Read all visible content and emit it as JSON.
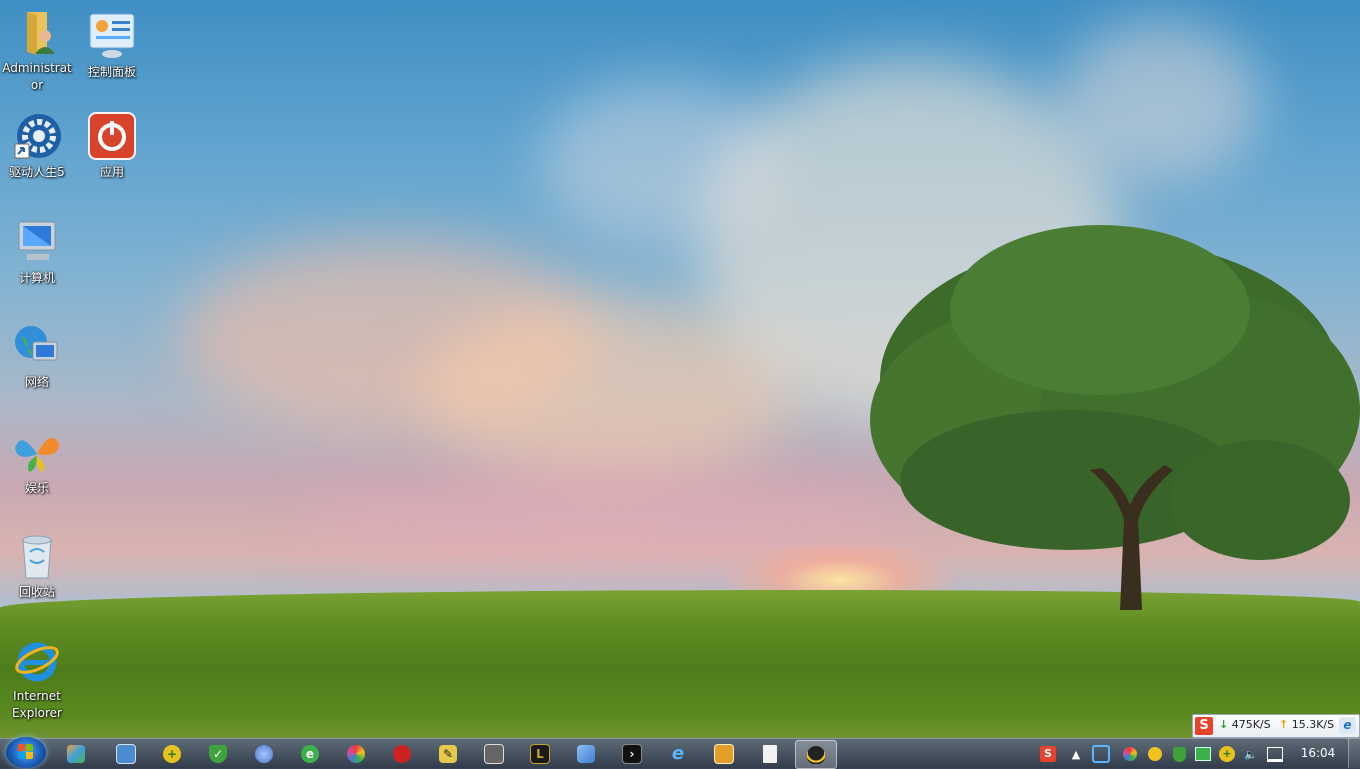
{
  "desktop": {
    "icons": [
      {
        "label": "Administrator",
        "icon": "user-folder-icon"
      },
      {
        "label": "控制面板",
        "icon": "control-panel-icon"
      },
      {
        "label": "驱动人生5",
        "icon": "gear-shortcut-icon"
      },
      {
        "label": "应用",
        "icon": "power-icon"
      },
      {
        "label": "计算机",
        "icon": "computer-icon"
      },
      {
        "label": "网络",
        "icon": "network-globe-icon"
      },
      {
        "label": "娱乐",
        "icon": "butterfly-icon"
      },
      {
        "label": "回收站",
        "icon": "recycle-bin-icon"
      },
      {
        "label": "Internet Explorer",
        "icon": "ie-icon"
      }
    ]
  },
  "taskbar": {
    "start_icon": "windows-flag-icon",
    "apps": [
      {
        "icon": "photo-app-icon",
        "color": "#f2a33a"
      },
      {
        "icon": "window-app-icon",
        "color": "#4b8ccf"
      },
      {
        "icon": "plus-circle-icon",
        "color": "#e8c21c"
      },
      {
        "icon": "shield-icon",
        "color": "#3fa33b"
      },
      {
        "icon": "globe-app-icon",
        "color": "#5577cc"
      },
      {
        "icon": "green-e-icon",
        "color": "#3cb04a"
      },
      {
        "icon": "pinwheel-icon",
        "color": "#d44b9c"
      },
      {
        "icon": "red-circle-icon",
        "color": "#cc2222"
      },
      {
        "icon": "pen-icon",
        "color": "#2f2f2f"
      },
      {
        "icon": "film-icon",
        "color": "#666666"
      },
      {
        "icon": "lol-icon",
        "color": "#c9a227"
      },
      {
        "icon": "cube-icon",
        "color": "#3f7fd0"
      },
      {
        "icon": "terminal-icon",
        "color": "#222222"
      },
      {
        "icon": "ie-icon",
        "color": "#2b84d8"
      },
      {
        "icon": "gift-box-icon",
        "color": "#e59c2a"
      },
      {
        "icon": "document-icon",
        "color": "#f2f2f2"
      },
      {
        "icon": "qq-penguin-icon",
        "color": "#222222"
      }
    ],
    "tray": [
      {
        "icon": "sogou-s-icon"
      },
      {
        "icon": "tray-expand-icon"
      },
      {
        "icon": "refresh-tray-icon"
      },
      {
        "icon": "pinwheel-tray-icon"
      },
      {
        "icon": "qq-tray-icon"
      },
      {
        "icon": "shield-tray-icon"
      },
      {
        "icon": "battery-tray-icon"
      },
      {
        "icon": "plus-tray-icon"
      },
      {
        "icon": "volume-icon"
      },
      {
        "icon": "network-tray-icon"
      }
    ],
    "clock": "16:04"
  },
  "net_speed": {
    "download": "475K/S",
    "upload": "15.3K/S"
  },
  "colors": {
    "taskbar": "#2d3650",
    "accent": "#1f74c9"
  }
}
